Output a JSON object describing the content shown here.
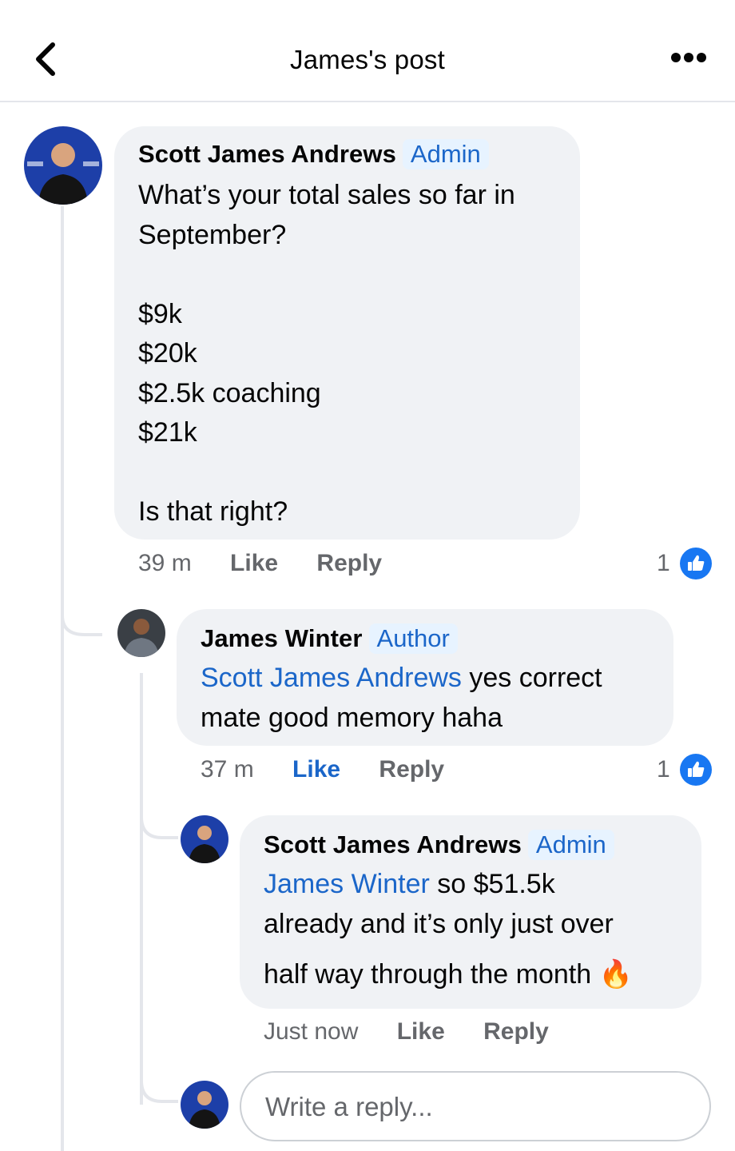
{
  "header": {
    "title": "James's post",
    "back_icon": "chevron-left-icon",
    "more_icon": "more-dots-icon"
  },
  "colors": {
    "link_blue": "#1b66c9",
    "like_blue": "#1877f2",
    "bubble_bg": "#f0f2f5",
    "meta_gray": "#65676b"
  },
  "comments": [
    {
      "author": "Scott James Andrews",
      "badge": "Admin",
      "lines": [
        "What’s your total sales so far in",
        "September?",
        "",
        "$9k",
        "$20k",
        "$2.5k coaching",
        "$21k",
        "",
        "Is that right?"
      ],
      "time": "39 m",
      "like_label": "Like",
      "reply_label": "Reply",
      "reaction_count": "1"
    },
    {
      "author": "James Winter",
      "badge": "Author",
      "mention": "Scott James Andrews",
      "text_after_mention": " yes correct",
      "line2": "mate good memory haha",
      "time": "37 m",
      "like_label": "Like",
      "reply_label": "Reply",
      "reaction_count": "1"
    },
    {
      "author": "Scott James Andrews",
      "badge": "Admin",
      "mention": "James Winter",
      "text_after_mention": " so $51.5k",
      "line2": "already and it’s only just over",
      "line3": "half way through the month",
      "emoji": "🔥",
      "time": "Just now",
      "like_label": "Like",
      "reply_label": "Reply"
    }
  ],
  "composer": {
    "placeholder": "Write a reply..."
  }
}
